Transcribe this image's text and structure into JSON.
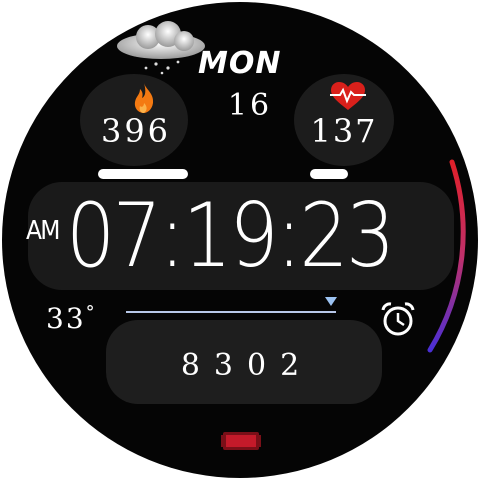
{
  "watch": {
    "day": "MON",
    "date": "16",
    "calories": "396",
    "heart_rate": "137",
    "ampm": "AM",
    "time": "07:19:23",
    "temperature": "33",
    "temperature_unit": "°",
    "steps": "8302",
    "weather": "cloudy-snow",
    "battery_arc_fraction": 0.55,
    "progress_fraction": 0.97
  },
  "icons": {
    "weather": "cloud-snow-icon",
    "calories": "flame-icon",
    "heart": "heart-pulse-icon",
    "alarm": "alarm-clock-icon",
    "battery": "battery-icon"
  },
  "colors": {
    "background": "#050505",
    "widget": "#1c1c1c",
    "flame": "#f47a12",
    "heart": "#d9201b",
    "progress_line": "#b7c7e8",
    "arc_top": "#d0202e",
    "arc_bottom": "#5a2fd0",
    "battery": "#b01020"
  }
}
